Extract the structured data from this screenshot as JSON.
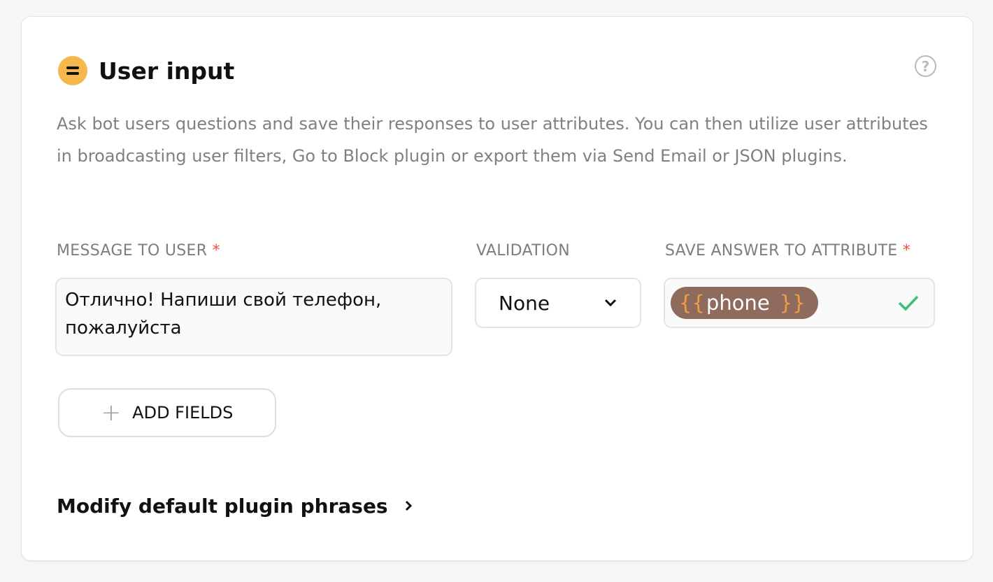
{
  "header": {
    "title": "User input",
    "help_icon": "?"
  },
  "description": "Ask bot users questions and save their responses to user attributes. You can then utilize user attributes in broadcasting user filters, Go to Block plugin or export them via Send Email or JSON plugins.",
  "fields": {
    "message_label": "MESSAGE TO USER",
    "message_value": "Отлично! Напиши свой телефон, пожалуйста",
    "validation_label": "VALIDATION",
    "validation_value": "None",
    "attribute_label": "SAVE ANSWER TO ATTRIBUTE",
    "attribute_value": "phone",
    "required_mark": "*",
    "brace_open": "{{",
    "brace_close": "}}"
  },
  "add_fields_label": "ADD FIELDS",
  "modify_link": "Modify default plugin phrases",
  "colors": {
    "accent": "#f6b84b",
    "chip": "#8e6b5c",
    "check": "#35c177",
    "required": "#e5563f"
  }
}
